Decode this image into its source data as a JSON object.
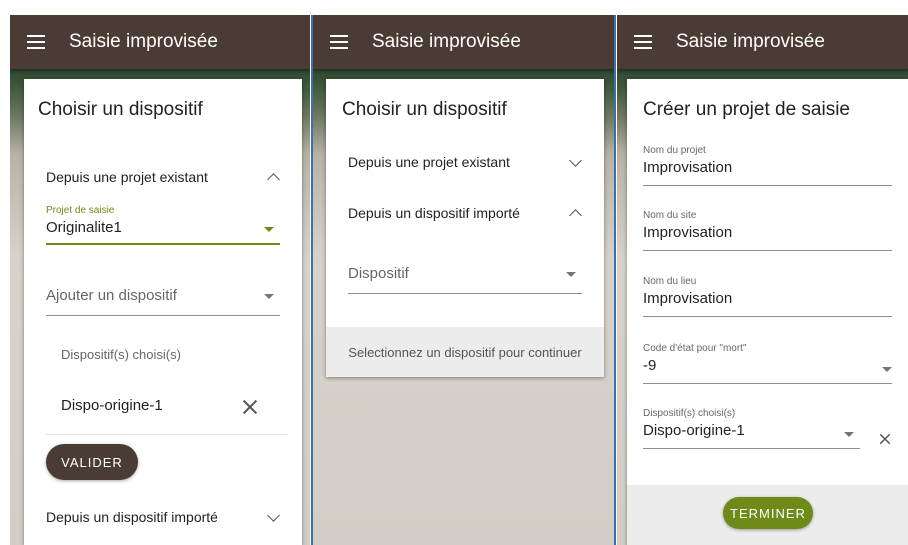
{
  "app": {
    "title": "Saisie improvisée"
  },
  "screen1": {
    "card_title": "Choisir un dispositif",
    "panel_existing": "Depuis une projet existant",
    "project_field": {
      "label": "Projet de saisie",
      "value": "Originalite1"
    },
    "add_device": {
      "placeholder": "Ajouter un dispositif"
    },
    "chosen_label": "Dispositif(s) choisi(s)",
    "chosen_item": "Dispo-origine-1",
    "validate_button": "VALIDER",
    "panel_imported": "Depuis un dispositif importé"
  },
  "screen2": {
    "card_title": "Choisir un dispositif",
    "panel_existing": "Depuis une projet existant",
    "panel_imported": "Depuis un dispositif importé",
    "device_select": {
      "placeholder": "Dispositif"
    },
    "footer_note": "Selectionnez un dispositif pour continuer"
  },
  "screen3": {
    "card_title": "Créer un projet de saisie",
    "project_name": {
      "label": "Nom du projet",
      "value": "Improvisation"
    },
    "site_name": {
      "label": "Nom du site",
      "value": "Improvisation"
    },
    "place_name": {
      "label": "Nom du lieu",
      "value": "Improvisation"
    },
    "dead_code": {
      "label": "Code d'état pour \"mort\"",
      "value": "-9"
    },
    "devices": {
      "label": "Dispositif(s) choisi(s)",
      "value": "Dispo-origine-1"
    },
    "finish_button": "TERMINER"
  },
  "colors": {
    "appbar": "#4a3b35",
    "accent_green": "#6e8b1a",
    "divider_blue": "#3b6fb0"
  }
}
